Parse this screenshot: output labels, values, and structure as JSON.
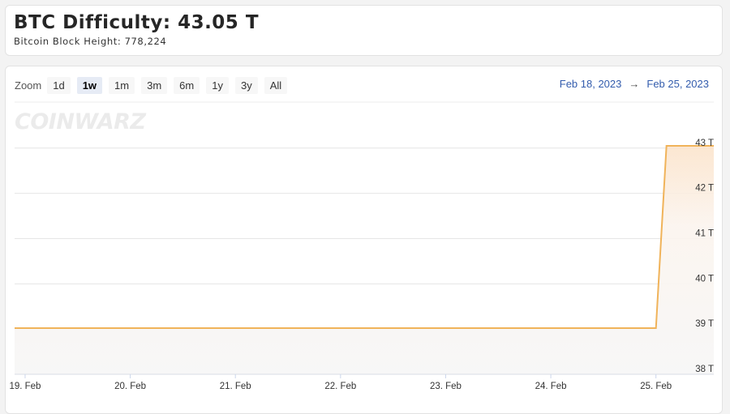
{
  "header": {
    "title": "BTC Difficulty: 43.05 T",
    "subtitle": "Bitcoin Block Height: 778,224"
  },
  "controls": {
    "zoom_label": "Zoom",
    "zoom_buttons": [
      "1d",
      "1w",
      "1m",
      "3m",
      "6m",
      "1y",
      "3y",
      "All"
    ],
    "active_zoom": "1w",
    "range_from": "Feb 18, 2023",
    "range_arrow": "→",
    "range_to": "Feb 25, 2023"
  },
  "watermark": "COINWARZ",
  "colors": {
    "series": "#f0b35a",
    "area_top": "#fbe7d2",
    "grid": "#e6e6e6",
    "axis_text": "#333333"
  },
  "chart_data": {
    "type": "area",
    "title": "BTC Difficulty: 43.05 T",
    "xlabel": "",
    "ylabel": "",
    "x_ticks": [
      "19. Feb",
      "20. Feb",
      "21. Feb",
      "22. Feb",
      "23. Feb",
      "24. Feb",
      "25. Feb"
    ],
    "y_ticks": [
      "38 T",
      "39 T",
      "40 T",
      "41 T",
      "42 T",
      "43 T"
    ],
    "y_tick_values": [
      38,
      39,
      40,
      41,
      42,
      43
    ],
    "ylim": [
      38,
      43.05
    ],
    "xlim": [
      18.9,
      25.55
    ],
    "grid": true,
    "legend": "none",
    "series": [
      {
        "x": [
          18.9,
          25.0,
          25.1,
          25.55
        ],
        "values": [
          39.02,
          39.02,
          43.05,
          43.05
        ]
      }
    ]
  }
}
